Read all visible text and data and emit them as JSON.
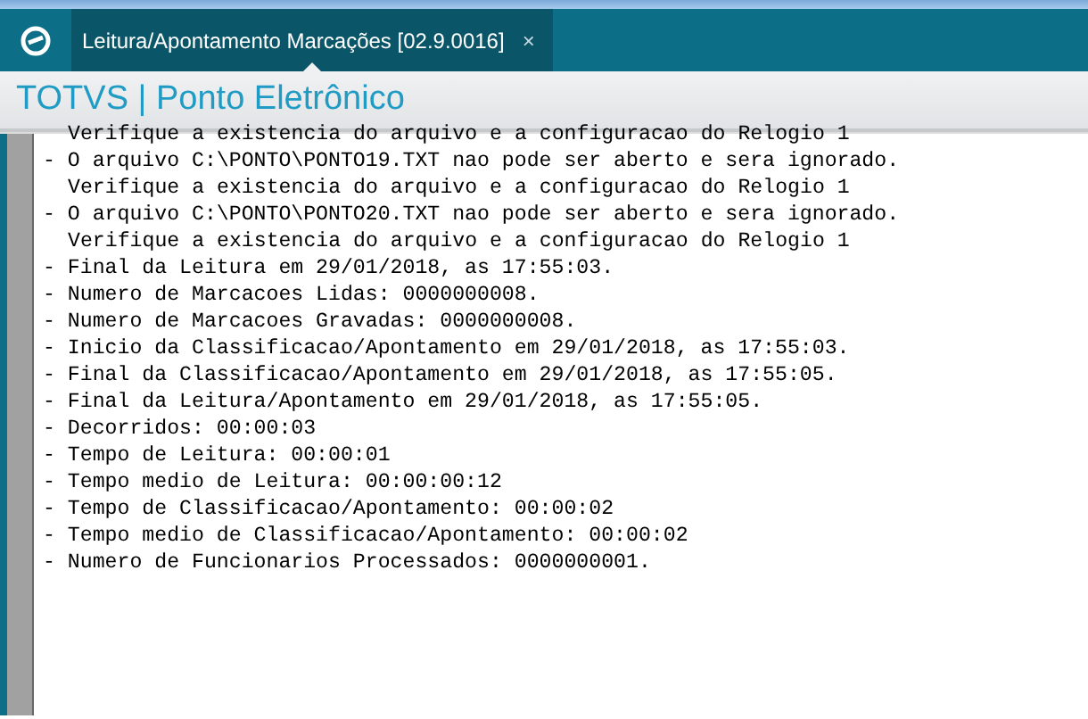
{
  "tab": {
    "label": "Leitura/Apontamento Marcações [02.9.0016]",
    "close": "×",
    "selected": true
  },
  "header": {
    "title": "TOTVS | Ponto Eletrônico"
  },
  "log": [
    {
      "kind": "note",
      "text": "Verifique a existencia do arquivo e a configuracao do Relogio 1"
    },
    {
      "kind": "item",
      "text": "- O arquivo C:\\PONTO\\PONTO19.TXT nao pode ser aberto e sera ignorado."
    },
    {
      "kind": "note",
      "text": "Verifique a existencia do arquivo e a configuracao do Relogio 1"
    },
    {
      "kind": "item",
      "text": "- O arquivo C:\\PONTO\\PONTO20.TXT nao pode ser aberto e sera ignorado."
    },
    {
      "kind": "note",
      "text": "Verifique a existencia do arquivo e a configuracao do Relogio 1"
    },
    {
      "kind": "item",
      "text": "- Final da Leitura em 29/01/2018, as 17:55:03."
    },
    {
      "kind": "item",
      "text": "- Numero de Marcacoes Lidas: 0000000008."
    },
    {
      "kind": "item",
      "text": "- Numero de Marcacoes Gravadas: 0000000008."
    },
    {
      "kind": "item",
      "text": "- Inicio da Classificacao/Apontamento em 29/01/2018, as 17:55:03."
    },
    {
      "kind": "item",
      "text": "- Final da Classificacao/Apontamento em 29/01/2018, as 17:55:05."
    },
    {
      "kind": "item",
      "text": "- Final da Leitura/Apontamento em 29/01/2018, as 17:55:05."
    },
    {
      "kind": "item",
      "text": "- Decorridos: 00:00:03"
    },
    {
      "kind": "item",
      "text": "- Tempo de Leitura: 00:00:01"
    },
    {
      "kind": "item",
      "text": "- Tempo medio de Leitura: 00:00:00:12"
    },
    {
      "kind": "item",
      "text": "- Tempo de Classificacao/Apontamento: 00:00:02"
    },
    {
      "kind": "item",
      "text": "- Tempo medio de Classificacao/Apontamento: 00:00:02"
    },
    {
      "kind": "item",
      "text": "- Numero de Funcionarios Processados: 0000000001."
    }
  ]
}
